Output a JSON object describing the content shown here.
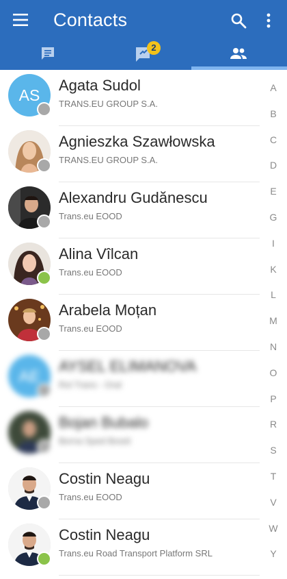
{
  "app": {
    "title": "Contacts"
  },
  "tabs": [
    {
      "name": "messages",
      "icon": "chat-icon",
      "selected": false
    },
    {
      "name": "notifications",
      "icon": "exchange-icon",
      "badge": "2",
      "selected": false
    },
    {
      "name": "contacts",
      "icon": "people-icon",
      "selected": true
    }
  ],
  "colors": {
    "appbar": "#2c6dbd",
    "indicator": "#7fb4ef",
    "badge": "#f2c21b",
    "online": "#8bc34a",
    "offline": "#a8a8a8"
  },
  "contacts": [
    {
      "name": "Agata Sudol",
      "company": "TRANS.EU GROUP S.A.",
      "initials": "AS",
      "status": "offline"
    },
    {
      "name": "Agnieszka Szawłowska",
      "company": "TRANS.EU GROUP S.A.",
      "status": "offline"
    },
    {
      "name": "Alexandru Gudănescu",
      "company": "Trans.eu EOOD",
      "status": "offline"
    },
    {
      "name": "Alina Vîlcan",
      "company": "Trans.eu EOOD",
      "status": "online"
    },
    {
      "name": "Arabela Moțan",
      "company": "Trans.eu EOOD",
      "status": "offline"
    },
    {
      "name": "AYSEL ELIMANOVA",
      "company": "Rol Trans - Oral",
      "initials": "AE",
      "status": "offline"
    },
    {
      "name": "Bojan Bubalo",
      "company": "Borna Sped Bosid",
      "status": "offline"
    },
    {
      "name": "Costin Neagu",
      "company": "Trans.eu EOOD",
      "status": "offline"
    },
    {
      "name": "Costin Neagu",
      "company": "Trans.eu Road Transport Platform SRL",
      "status": "online"
    }
  ],
  "index_letters": [
    "A",
    "B",
    "C",
    "D",
    "E",
    "G",
    "I",
    "K",
    "L",
    "M",
    "N",
    "O",
    "P",
    "R",
    "S",
    "T",
    "V",
    "W",
    "Y"
  ]
}
